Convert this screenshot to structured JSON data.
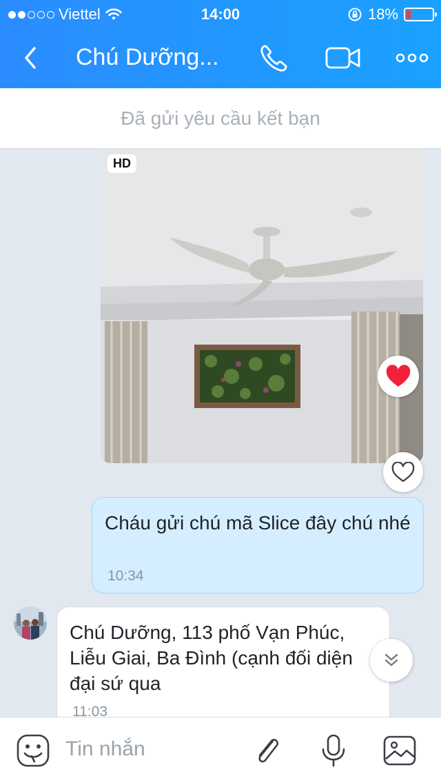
{
  "status_bar": {
    "carrier": "Viettel",
    "time": "14:00",
    "battery": "18%",
    "battery_level": 0.18,
    "signal_bars_filled": 2,
    "signal_bars_total": 5
  },
  "header": {
    "title": "Chú Dưỡng...",
    "icons": [
      "back-chevron-icon",
      "phone-icon",
      "video-call-icon",
      "more-options-icon"
    ]
  },
  "banner": {
    "text": "Đã gửi yêu cầu kết bạn"
  },
  "messages": [
    {
      "type": "photo",
      "badge": "HD",
      "reaction": "red-heart-icon"
    },
    {
      "type": "text",
      "direction": "outgoing",
      "text": "Cháu gửi chú mã Slice đây chú nhé",
      "time": "10:34"
    },
    {
      "type": "text",
      "direction": "incoming",
      "text": "Chú Dưỡng, 113 phố Vạn Phúc, Liễu Giai, Ba Đình (cạnh đối diện đại sứ qua",
      "time": "11:03"
    }
  ],
  "input": {
    "placeholder": "Tin nhắn",
    "icons": [
      "sticker-icon",
      "attachment-icon",
      "microphone-icon",
      "image-icon"
    ]
  },
  "colors": {
    "header_start": "#2b8cff",
    "header_end": "#1aa1ff",
    "outgoing_bubble": "#d5eeff",
    "incoming_bubble": "#ffffff",
    "chat_background": "#e2e8ef"
  }
}
